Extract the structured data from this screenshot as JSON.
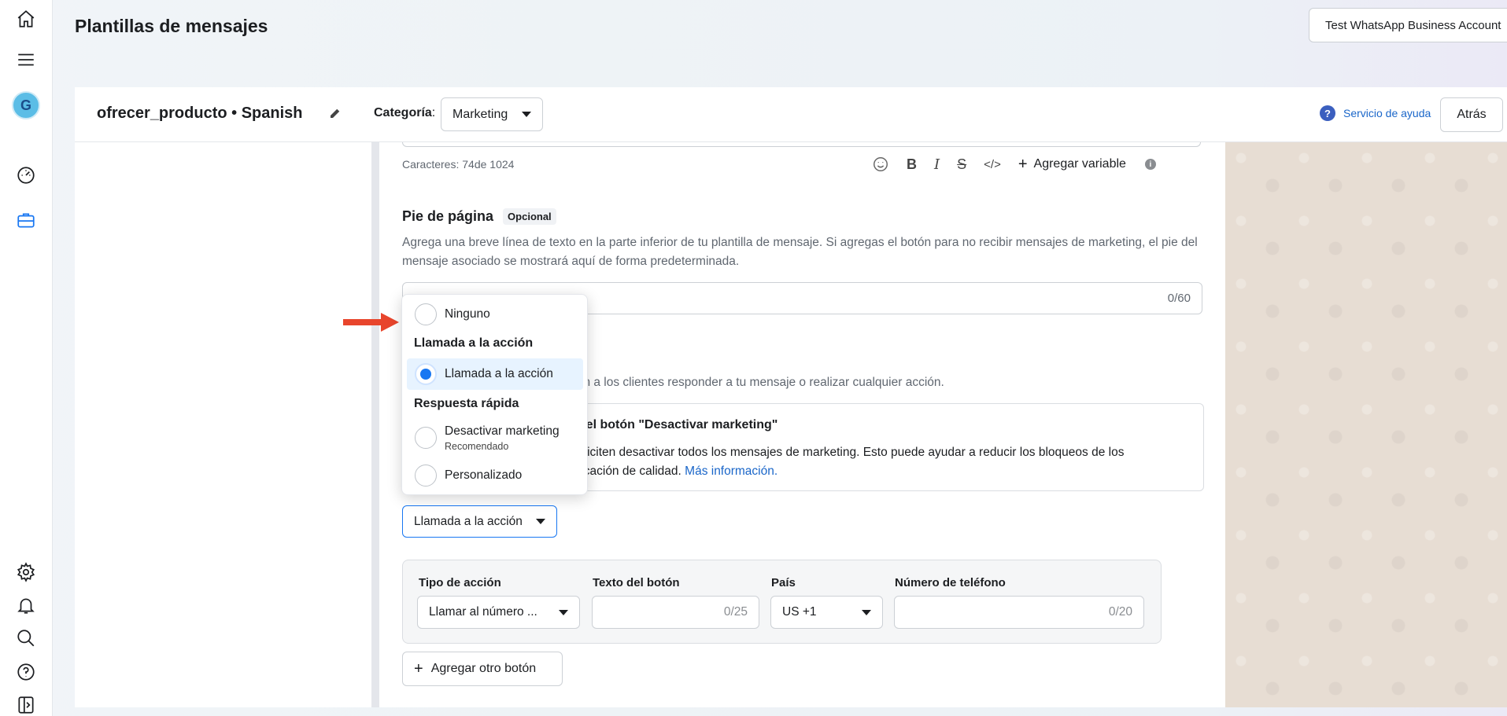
{
  "header": {
    "title": "Plantillas de mensajes",
    "account_button": "Test WhatsApp Business Account"
  },
  "rail": {
    "avatar_initial": "G",
    "accent_color": "#1877f2"
  },
  "template_bar": {
    "name": "ofrecer_producto • Spanish",
    "category_label": "Categoría",
    "category_value": "Marketing",
    "help_link": "Servicio de ayuda",
    "back_button": "Atrás"
  },
  "body_editor": {
    "char_count": "Caracteres: 74de 1024",
    "toolbar": {
      "bold": "B",
      "italic": "I",
      "strike": "S",
      "code": "</>",
      "add_variable": "Agregar variable"
    }
  },
  "footer": {
    "title": "Pie de página",
    "badge": "Opcional",
    "description": "Agrega una breve línea de texto en la parte inferior de tu plantilla de mensaje. Si agregas el botón para no recibir mensajes de marketing, el pie del mensaje asociado se mostrará aquí de forma predeterminada.",
    "counter": "0/60"
  },
  "buttons": {
    "description_visible": "rmitan a los clientes responder a tu mensaje o realizar cualquier acción.",
    "optout_title_visible": "r el botón \"Desactivar marketing\"",
    "optout_text_visible_1": "oliciten desactivar todos los mensajes de marketing. Esto puede ayudar a reducir los bloqueos de los",
    "optout_text_visible_2": "ficación de calidad.",
    "optout_link": "Más información.",
    "selected_type": "Llamada a la acción",
    "add_button": "Agregar otro botón"
  },
  "action_panel": {
    "action_type_label": "Tipo de acción",
    "action_type_value": "Llamar al número ...",
    "button_text_label": "Texto del botón",
    "button_text_counter": "0/25",
    "country_label": "País",
    "country_value": "US +1",
    "phone_label": "Número de teléfono",
    "phone_counter": "0/20"
  },
  "dropdown": {
    "none": "Ninguno",
    "group_cta": "Llamada a la acción",
    "cta_option": "Llamada a la acción",
    "group_quick": "Respuesta rápida",
    "optout_option": "Desactivar marketing",
    "optout_sub": "Recomendado",
    "custom_option": "Personalizado"
  }
}
